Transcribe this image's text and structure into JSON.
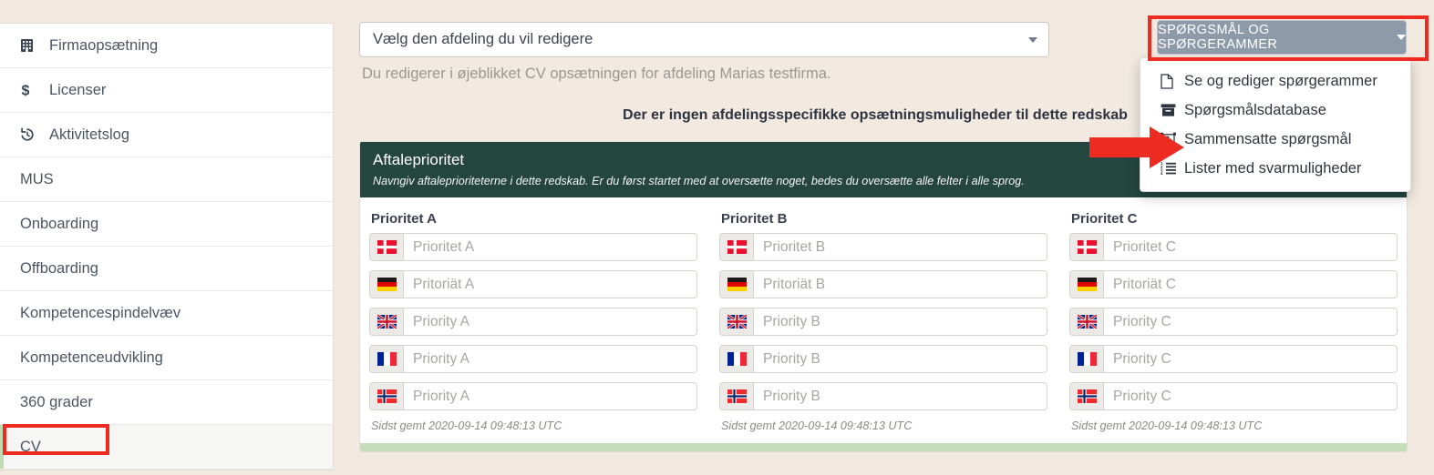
{
  "colors": {
    "page_bg": "#f2eae0",
    "panel_dark": "#25463f",
    "card_footer_green": "#c5ddb8",
    "button_bg": "#8d9aa8",
    "annotation_red": "#ed2b21",
    "active_item_accent": "#bedbb2"
  },
  "sidebar": {
    "items": [
      {
        "label": "Firmaopsætning",
        "icon": "building-icon",
        "active": false
      },
      {
        "label": "Licenser",
        "icon": "dollar-icon",
        "active": false
      },
      {
        "label": "Aktivitetslog",
        "icon": "history-icon",
        "active": false
      },
      {
        "label": "MUS",
        "icon": "",
        "active": false
      },
      {
        "label": "Onboarding",
        "icon": "",
        "active": false
      },
      {
        "label": "Offboarding",
        "icon": "",
        "active": false
      },
      {
        "label": "Kompetencespindelvæv",
        "icon": "",
        "active": false
      },
      {
        "label": "Kompetenceudvikling",
        "icon": "",
        "active": false
      },
      {
        "label": "360 grader",
        "icon": "",
        "active": false
      },
      {
        "label": "CV",
        "icon": "",
        "active": true
      }
    ]
  },
  "main": {
    "department_select": {
      "value": "Vælg den afdeling du vil redigere",
      "placeholder": "Vælg den afdeling du vil redigere"
    },
    "department_help": "Du redigerer i øjeblikket CV opsætningen for afdeling Marias testfirma.",
    "no_options_notice": "Der er ingen afdelingsspecifikke opsætningsmuligheder til dette redskab",
    "questions_button": {
      "label": "SPØRGSMÅL OG SPØRGERAMMER",
      "caret": "chevron-down-icon"
    },
    "questions_menu": {
      "items": [
        {
          "label": "Se og rediger spørgerammer",
          "icon": "file-icon"
        },
        {
          "label": "Spørgsmålsdatabase",
          "icon": "archive-box-icon"
        },
        {
          "label": "Sammensatte spørgsmål",
          "icon": "object-group-icon"
        },
        {
          "label": "Lister med svarmuligheder",
          "icon": "ordered-list-icon"
        }
      ]
    }
  },
  "card": {
    "title": "Aftaleprioritet",
    "subtitle": "Navngiv aftaleprioriteterne i dette redskab. Er du først startet med at oversætte noget, bedes du oversætte alle felter i alle sprog.",
    "columns": [
      {
        "title": "Prioritet A",
        "saved": "Sidst gemt 2020-09-14 09:48:13 UTC",
        "fields": [
          {
            "flag": "flag-dk-icon",
            "lang": "da",
            "value": "",
            "placeholder": "Prioritet A"
          },
          {
            "flag": "flag-de-icon",
            "lang": "de",
            "value": "",
            "placeholder": "Pritoriät A"
          },
          {
            "flag": "flag-gb-icon",
            "lang": "en",
            "value": "",
            "placeholder": "Priority A"
          },
          {
            "flag": "flag-fr-icon",
            "lang": "fr",
            "value": "",
            "placeholder": "Priority A"
          },
          {
            "flag": "flag-no-icon",
            "lang": "no",
            "value": "",
            "placeholder": "Priority A"
          }
        ]
      },
      {
        "title": "Prioritet B",
        "saved": "Sidst gemt 2020-09-14 09:48:13 UTC",
        "fields": [
          {
            "flag": "flag-dk-icon",
            "lang": "da",
            "value": "",
            "placeholder": "Prioritet B"
          },
          {
            "flag": "flag-de-icon",
            "lang": "de",
            "value": "",
            "placeholder": "Pritoriät B"
          },
          {
            "flag": "flag-gb-icon",
            "lang": "en",
            "value": "",
            "placeholder": "Priority B"
          },
          {
            "flag": "flag-fr-icon",
            "lang": "fr",
            "value": "",
            "placeholder": "Priority B"
          },
          {
            "flag": "flag-no-icon",
            "lang": "no",
            "value": "",
            "placeholder": "Priority B"
          }
        ]
      },
      {
        "title": "Prioritet C",
        "saved": "Sidst gemt 2020-09-14 09:48:13 UTC",
        "fields": [
          {
            "flag": "flag-dk-icon",
            "lang": "da",
            "value": "",
            "placeholder": "Prioritet C"
          },
          {
            "flag": "flag-de-icon",
            "lang": "de",
            "value": "",
            "placeholder": "Pritoriät C"
          },
          {
            "flag": "flag-gb-icon",
            "lang": "en",
            "value": "",
            "placeholder": "Priority C"
          },
          {
            "flag": "flag-fr-icon",
            "lang": "fr",
            "value": "",
            "placeholder": "Priority C"
          },
          {
            "flag": "flag-no-icon",
            "lang": "no",
            "value": "",
            "placeholder": "Priority C"
          }
        ]
      }
    ]
  },
  "annotations": {
    "button_highlight": "red-rectangle-around-questions-button",
    "menu_arrow": "red-arrow-pointing-to-sammensatte-sporgsmal",
    "sidebar_highlight": "red-rectangle-around-cv-item"
  }
}
